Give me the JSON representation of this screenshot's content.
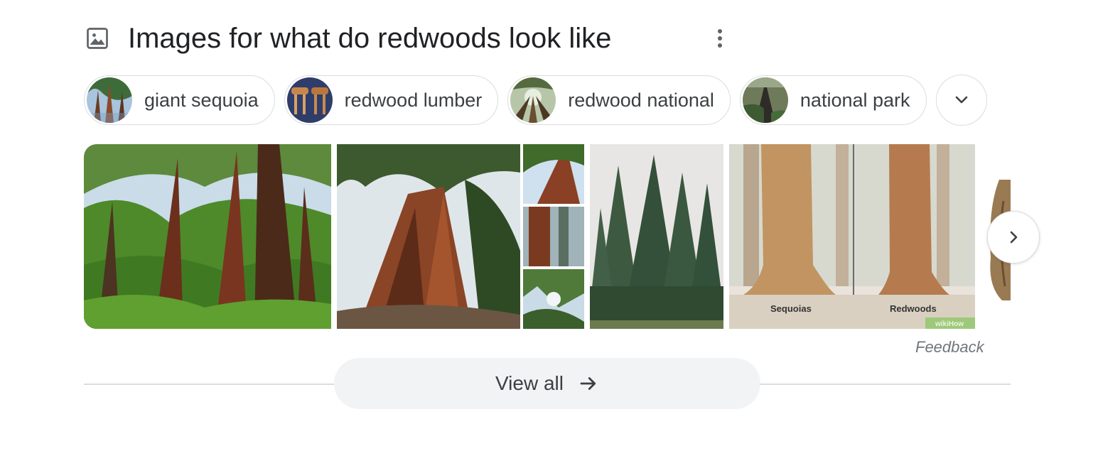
{
  "header": {
    "title": "Images for what do redwoods look like",
    "icon": "image-icon",
    "more_icon": "more-vert-icon"
  },
  "chips": [
    {
      "label": "giant sequoia"
    },
    {
      "label": "redwood lumber"
    },
    {
      "label": "redwood national"
    },
    {
      "label": "national park"
    }
  ],
  "chips_expand_icon": "chevron-down-icon",
  "images": {
    "tile5_captions": {
      "left": "Sequoias",
      "right": "Redwoods",
      "watermark": "wikiHow"
    }
  },
  "next_icon": "chevron-right-icon",
  "feedback": "Feedback",
  "view_all": {
    "label": "View all",
    "icon": "arrow-right-icon"
  },
  "colors": {
    "text": "#202124",
    "chip_border": "#dadce0",
    "view_all_bg": "#f1f3f4",
    "feedback": "#70757a"
  }
}
